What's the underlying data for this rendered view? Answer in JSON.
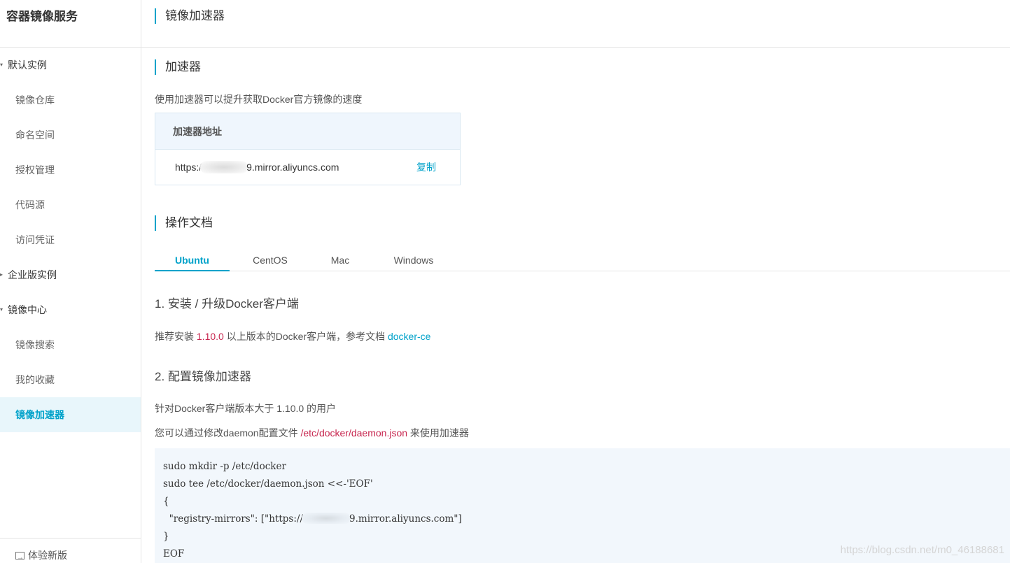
{
  "sidebar": {
    "title": "容器镜像服务",
    "groups": [
      {
        "label": "默认实例",
        "caret": "▾",
        "items": [
          {
            "label": "镜像仓库"
          },
          {
            "label": "命名空间"
          },
          {
            "label": "授权管理"
          },
          {
            "label": "代码源"
          },
          {
            "label": "访问凭证"
          }
        ]
      },
      {
        "label": "企业版实例",
        "caret": "▸",
        "items": []
      },
      {
        "label": "镜像中心",
        "caret": "▾",
        "items": [
          {
            "label": "镜像搜索"
          },
          {
            "label": "我的收藏"
          },
          {
            "label": "镜像加速器",
            "active": true
          }
        ]
      }
    ],
    "footer": {
      "label": "体验新版",
      "icon": "external-switch-icon"
    }
  },
  "page": {
    "title": "镜像加速器",
    "accelerator": {
      "title": "加速器",
      "description": "使用加速器可以提升获取Docker官方镜像的速度",
      "box_header": "加速器地址",
      "address_prefix": "https:/",
      "address_suffix": "9.mirror.aliyuncs.com",
      "copy_label": "复制"
    },
    "docs": {
      "title": "操作文档",
      "tabs": [
        {
          "label": "Ubuntu",
          "active": true
        },
        {
          "label": "CentOS"
        },
        {
          "label": "Mac"
        },
        {
          "label": "Windows"
        }
      ],
      "step1": {
        "heading": "1. 安装 / 升级Docker客户端",
        "text_before": "推荐安装",
        "version": "1.10.0",
        "text_after": "以上版本的Docker客户端，参考文档",
        "link": "docker-ce"
      },
      "step2": {
        "heading": "2. 配置镜像加速器",
        "line1": "针对Docker客户端版本大于 1.10.0 的用户",
        "line2_before": "您可以通过修改daemon配置文件",
        "line2_path": "/etc/docker/daemon.json",
        "line2_after": "来使用加速器"
      },
      "code": {
        "line1": "sudo mkdir -p /etc/docker",
        "line2": "sudo tee /etc/docker/daemon.json <<-'EOF'",
        "line3": "{",
        "line4_prefix": "  \"registry-mirrors\": [\"https://",
        "line4_suffix": "9.mirror.aliyuncs.com\"]",
        "line5": "}",
        "line6": "EOF"
      }
    }
  },
  "watermark": "https://blog.csdn.net/m0_46188681",
  "colors": {
    "accent": "#00a2ca",
    "code_red": "#c7254e",
    "code_bg": "#f2f7fc"
  }
}
